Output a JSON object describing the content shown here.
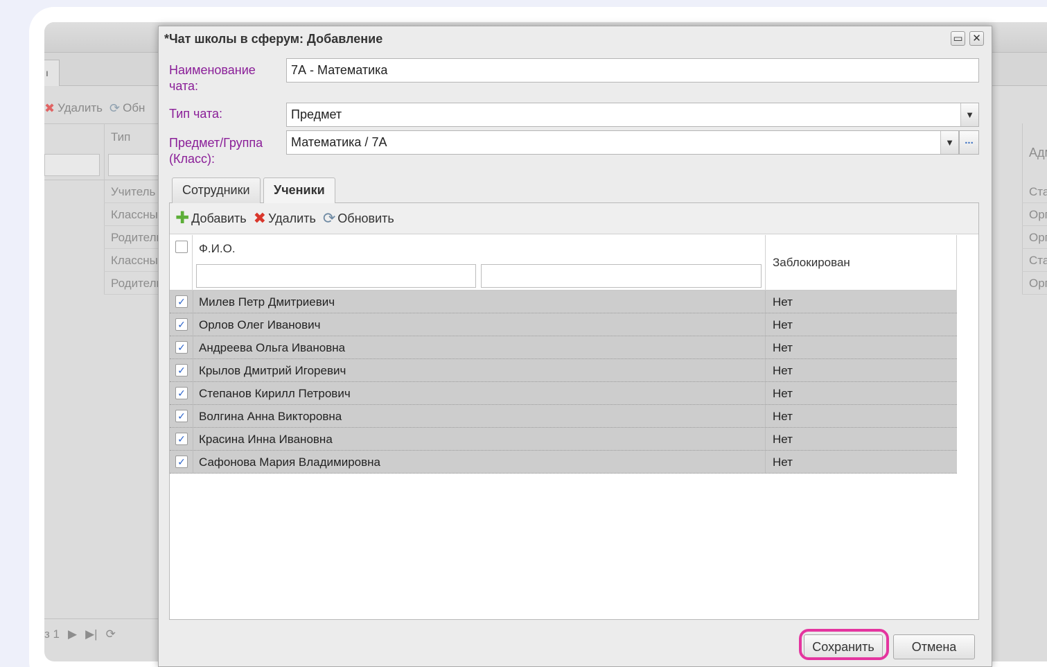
{
  "background_app": {
    "tab_label": "ı",
    "toolbar": {
      "delete_label": "Удалить",
      "refresh_label": "Обн"
    },
    "column_type_header": "Тип",
    "type_rows": [
      "Учитель",
      "Классный",
      "Родитель",
      "Классный",
      "Родитель"
    ],
    "right_header": "Адм",
    "right_rows": [
      "Ста",
      "Орг",
      "Орг",
      "Ста",
      "Орг"
    ],
    "pager_text": "з 1"
  },
  "dialog": {
    "title": "*Чат школы в сферум: Добавление",
    "form": {
      "name_label": "Наименование чата:",
      "name_value": "7А - Математика",
      "type_label": "Тип чата:",
      "type_value": "Предмет",
      "subject_label": "Предмет/Группа (Класс):",
      "subject_value": "Математика / 7А",
      "more_button": "..."
    },
    "tabs": [
      {
        "label": "Сотрудники",
        "active": false
      },
      {
        "label": "Ученики",
        "active": true
      }
    ],
    "toolbar": {
      "add_label": "Добавить",
      "delete_label": "Удалить",
      "refresh_label": "Обновить"
    },
    "grid": {
      "columns": {
        "fio": "Ф.И.О.",
        "blocked": "Заблокирован"
      },
      "rows": [
        {
          "name": "Милев Петр Дмитриевич",
          "blocked": "Нет",
          "checked": true
        },
        {
          "name": "Орлов Олег Иванович",
          "blocked": "Нет",
          "checked": true
        },
        {
          "name": "Андреева Ольга Ивановна",
          "blocked": "Нет",
          "checked": true
        },
        {
          "name": "Крылов Дмитрий Игоревич",
          "blocked": "Нет",
          "checked": true
        },
        {
          "name": "Степанов Кирилл Петрович",
          "blocked": "Нет",
          "checked": true
        },
        {
          "name": "Волгина Анна Викторовна",
          "blocked": "Нет",
          "checked": true
        },
        {
          "name": "Красина Инна Ивановна",
          "blocked": "Нет",
          "checked": true
        },
        {
          "name": "Сафонова Мария Владимировна",
          "blocked": "Нет",
          "checked": true
        }
      ]
    },
    "buttons": {
      "save": "Сохранить",
      "cancel": "Отмена"
    }
  },
  "colors": {
    "label_purple": "#8a1e98",
    "highlight_pink": "#e4359f",
    "row_gray": "#cdcdcd"
  }
}
